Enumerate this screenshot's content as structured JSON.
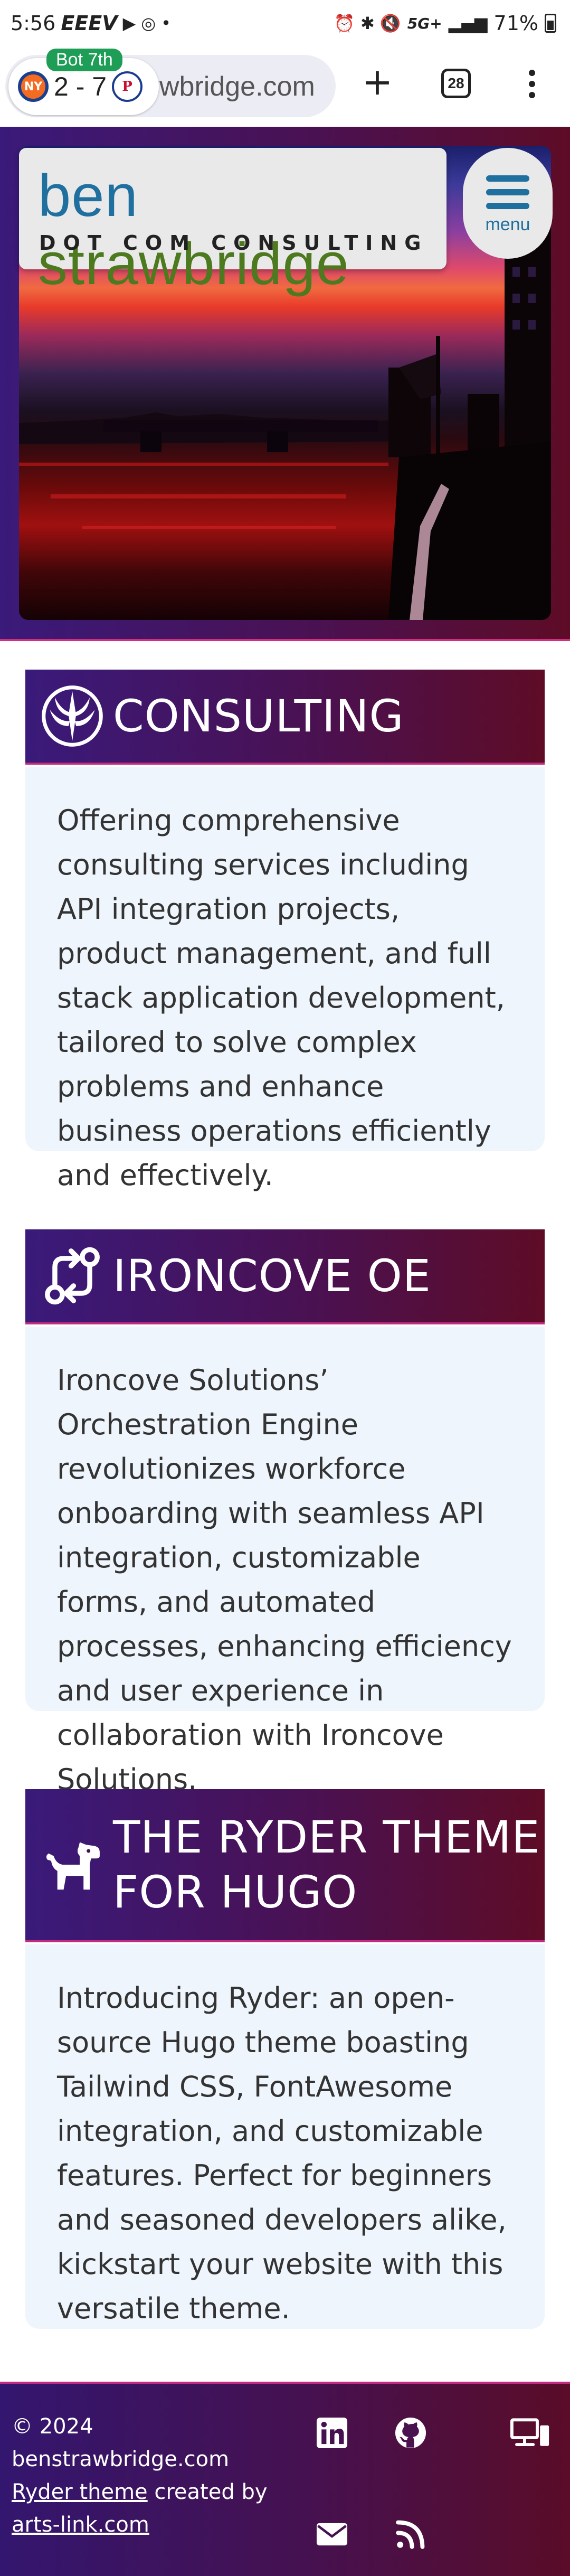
{
  "status_bar": {
    "time": "5:56",
    "notification_glyphs": "EEEV",
    "right_glyphs": "⏰ ✱ 🔇",
    "network": "5G+",
    "battery": "71%"
  },
  "browser": {
    "score": "2 - 7",
    "inning": "Bot 7th",
    "url": "wbridge.com",
    "tab_count": "28"
  },
  "hero": {
    "logo_first": "ben ",
    "logo_last": "strawbridge",
    "tagline": "DOT COM CONSULTING",
    "menu_label": "menu"
  },
  "cards": [
    {
      "title": "CONSULTING",
      "icon": "jedi-emblem-icon",
      "body": "Offering comprehensive consulting services including API integration projects, product management, and full stack application development, tailored to solve complex problems and enhance business operations efficiently and effectively."
    },
    {
      "title": "IRONCOVE OE",
      "icon": "arrows-rotate-icon",
      "body": "Ironcove Solutions’ Orchestration Engine revolutionizes workforce onboarding with seamless API integration, customizable forms, and automated processes, enhancing efficiency and user experience in collaboration with Ironcove Solutions."
    },
    {
      "title_line1": "THE RYDER THEME",
      "title_line2": "FOR HUGO",
      "icon": "dog-icon",
      "body": "Introducing Ryder: an open-source Hugo theme boasting Tailwind CSS, FontAwesome integration, and customizable features. Perfect for beginners and seasoned developers alike, kickstart your website with this versatile theme."
    }
  ],
  "footer": {
    "copyright": "© 2024",
    "site": "benstrawbridge.com",
    "theme_link": "Ryder theme",
    "created_by": " created by",
    "author_link": "arts-link.com",
    "icons": [
      "linkedin-icon",
      "github-icon",
      "devices-icon",
      "envelope-icon",
      "rss-icon"
    ]
  },
  "colors": {
    "brand_blue": "#1f6f9f",
    "brand_green": "#4d7a1f",
    "header_gradient_start": "#3a1a7a",
    "header_gradient_end": "#5e0c26",
    "card_body_bg": "#eef5fc"
  }
}
